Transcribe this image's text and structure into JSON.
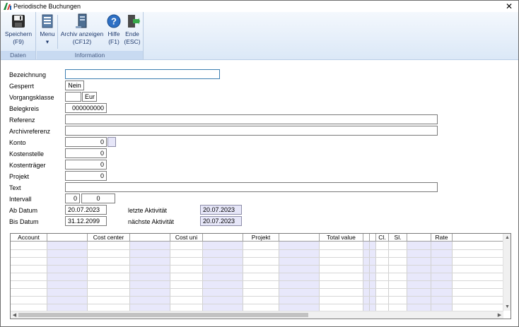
{
  "window": {
    "title": "Periodische Buchungen",
    "close_glyph": "✕"
  },
  "ribbon": {
    "groups": [
      {
        "label": "Daten",
        "buttons": [
          {
            "label": "Speichern",
            "sub": "(F9)",
            "icon": "save-icon"
          }
        ]
      },
      {
        "label": "Information",
        "buttons": [
          {
            "label": "Menu",
            "sub": "▾",
            "icon": "menu-icon"
          },
          {
            "label": "Archiv anzeigen",
            "sub": "(CF12)",
            "icon": "archive-icon"
          },
          {
            "label": "Hilfe",
            "sub": "(F1)",
            "icon": "help-icon"
          },
          {
            "label": "Ende",
            "sub": "(ESC)",
            "icon": "exit-icon"
          }
        ]
      }
    ]
  },
  "form": {
    "bezeichnung": {
      "label": "Bezeichnung",
      "value": ""
    },
    "gesperrt": {
      "label": "Gesperrt",
      "value": "Nein"
    },
    "vorgangsklasse": {
      "label": "Vorgangsklasse",
      "value": "",
      "currency": "Eur"
    },
    "belegkreis": {
      "label": "Belegkreis",
      "value": "000000000"
    },
    "referenz": {
      "label": "Referenz",
      "value": ""
    },
    "archivreferenz": {
      "label": "Archivreferenz",
      "value": ""
    },
    "konto": {
      "label": "Konto",
      "value": "0",
      "extra": ""
    },
    "kostenstelle": {
      "label": "Kostenstelle",
      "value": "0"
    },
    "kostentraeger": {
      "label": "Kostenträger",
      "value": "0"
    },
    "projekt": {
      "label": "Projekt",
      "value": "0"
    },
    "text": {
      "label": "Text",
      "value": ""
    },
    "intervall": {
      "label": "Intervall",
      "value1": "0",
      "value2": "0"
    },
    "ab_datum": {
      "label": "Ab  Datum",
      "value": "20.07.2023"
    },
    "bis_datum": {
      "label": "Bis Datum",
      "value": "31.12.2099"
    },
    "letzte_aktivitaet": {
      "label": "letzte Aktivität",
      "value": "20.07.2023"
    },
    "naechste_aktivitaet": {
      "label": "nächste Aktivität",
      "value": "20.07.2023"
    }
  },
  "grid": {
    "columns": [
      "Account",
      "",
      "Cost center",
      "",
      "Cost uni",
      "",
      "Projekt",
      "",
      "Total value",
      "",
      "",
      "Cl.",
      "Sl.",
      "",
      "Rate",
      ""
    ]
  }
}
